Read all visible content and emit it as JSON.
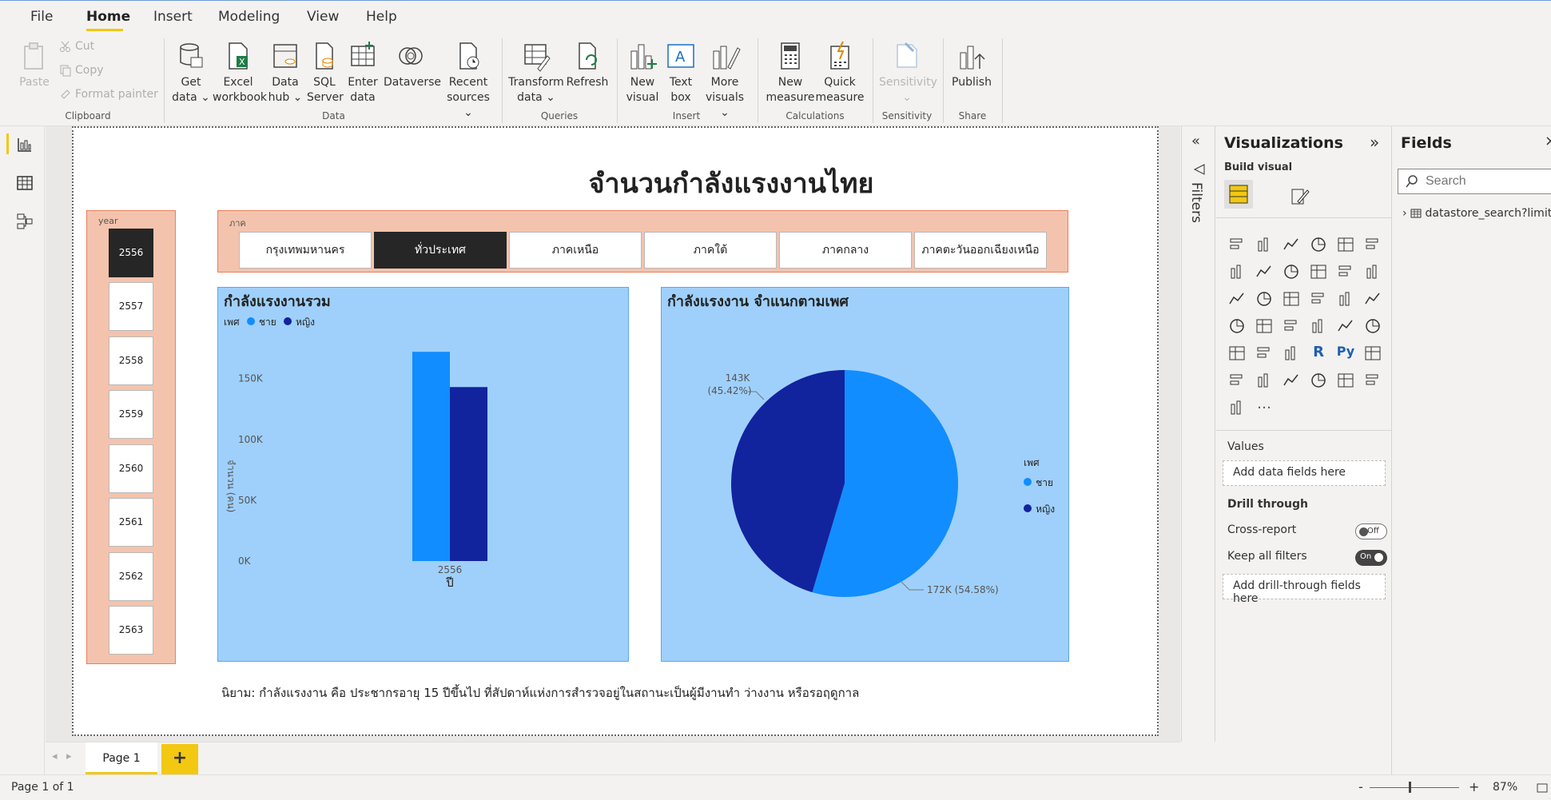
{
  "menu": {
    "items": [
      "File",
      "Home",
      "Insert",
      "Modeling",
      "View",
      "Help"
    ],
    "active": "Home"
  },
  "ribbon": {
    "clipboard": {
      "paste": "Paste",
      "cut": "Cut",
      "copy": "Copy",
      "format_painter": "Format painter",
      "label": "Clipboard"
    },
    "data": {
      "get_data": [
        "Get",
        "data"
      ],
      "excel": [
        "Excel",
        "workbook"
      ],
      "data_hub": [
        "Data",
        "hub"
      ],
      "sql": [
        "SQL",
        "Server"
      ],
      "enter": [
        "Enter",
        "data"
      ],
      "dataverse": "Dataverse",
      "recent": [
        "Recent",
        "sources"
      ],
      "label": "Data"
    },
    "queries": {
      "transform": [
        "Transform",
        "data"
      ],
      "refresh": "Refresh",
      "label": "Queries"
    },
    "insert": {
      "new_visual": [
        "New",
        "visual"
      ],
      "text_box": [
        "Text",
        "box"
      ],
      "more_visuals": [
        "More",
        "visuals"
      ],
      "label": "Insert"
    },
    "calculations": {
      "new_measure": [
        "New",
        "measure"
      ],
      "quick_measure": [
        "Quick",
        "measure"
      ],
      "label": "Calculations"
    },
    "sensitivity": {
      "button": "Sensitivity",
      "label": "Sensitivity"
    },
    "share": {
      "publish": "Publish",
      "label": "Share"
    }
  },
  "report": {
    "title": "จำนวนกำลังแรงงานไทย",
    "year_slicer": {
      "title": "year",
      "items": [
        "2556",
        "2557",
        "2558",
        "2559",
        "2560",
        "2561",
        "2562",
        "2563"
      ],
      "selected": "2556"
    },
    "region_slicer": {
      "title": "ภาค",
      "items": [
        "กรุงเทพมหานคร",
        "ทั่วประเทศ",
        "ภาคเหนือ",
        "ภาคใต้",
        "ภาคกลาง",
        "ภาคตะวันออกเฉียงเหนือ"
      ],
      "selected": "ทั่วประเทศ"
    },
    "footnote": "นิยาม: กำลังแรงงาน คือ ประชากรอายุ 15 ปีขึ้นไป ที่สัปดาห์แห่งการสำรวจอยู่ในสถานะเป็นผู้มีงานทำ ว่างงาน หรือรอฤดูกาล"
  },
  "colors": {
    "male": "#118dff",
    "female": "#12239e",
    "visual_bg": "#9fd0fb",
    "slicer_bg": "#f4c3ad",
    "accent": "#f2c811"
  },
  "chart_data": [
    {
      "type": "bar",
      "title": "กำลังแรงงานรวม",
      "legend_title": "เพศ",
      "categories": [
        "2556"
      ],
      "series": [
        {
          "name": "ชาย",
          "values": [
            172000
          ]
        },
        {
          "name": "หญิง",
          "values": [
            143000
          ]
        }
      ],
      "xlabel": "ปี",
      "ylabel": "จำนวน (คน)",
      "yticks": [
        "0K",
        "50K",
        "100K",
        "150K"
      ],
      "ylim": [
        0,
        180000
      ],
      "legend": "top-left"
    },
    {
      "type": "pie",
      "title": "กำลังแรงงาน จำแนกตามเพศ",
      "legend_title": "เพศ",
      "slices": [
        {
          "name": "ชาย",
          "value": 172000,
          "label": "172K (54.58%)"
        },
        {
          "name": "หญิง",
          "value": 143000,
          "label": "143K (45.42%)"
        }
      ],
      "legend": "right"
    }
  ],
  "panes": {
    "filters": "Filters",
    "visualizations": {
      "title": "Visualizations",
      "build_visual": "Build visual",
      "values": "Values",
      "add_data_fields": "Add data fields here",
      "drill_through": "Drill through",
      "cross_report": "Cross-report",
      "cross_report_state": "Off",
      "keep_all_filters": "Keep all filters",
      "keep_all_filters_state": "On",
      "add_drill_through": "Add drill-through fields here"
    },
    "fields": {
      "title": "Fields",
      "search_placeholder": "Search",
      "table": "datastore_search?limit..."
    }
  },
  "pages": {
    "current": "Page 1",
    "add": "+"
  },
  "status": {
    "page_info": "Page 1 of 1",
    "zoom": "87%"
  }
}
